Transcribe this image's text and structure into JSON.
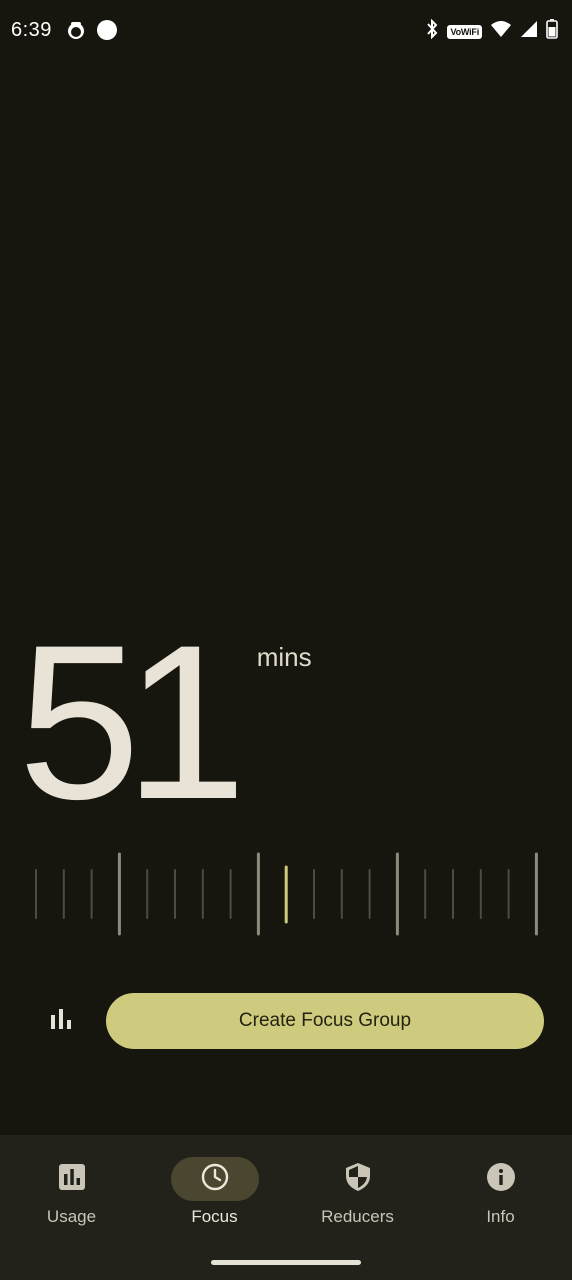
{
  "status_bar": {
    "time": "6:39",
    "network_badge": "VoWiFi"
  },
  "timer": {
    "value": "51",
    "unit": "mins"
  },
  "ruler": {
    "tick_count": 19,
    "selected_index": 9,
    "major_every": 5
  },
  "actions": {
    "stats_icon": "bar-chart-icon",
    "create_label": "Create Focus Group"
  },
  "nav": {
    "items": [
      {
        "label": "Usage",
        "icon": "usage-chart-icon",
        "active": false
      },
      {
        "label": "Focus",
        "icon": "clock-icon",
        "active": true
      },
      {
        "label": "Reducers",
        "icon": "shield-icon",
        "active": false
      },
      {
        "label": "Info",
        "icon": "info-icon",
        "active": false
      }
    ]
  },
  "colors": {
    "background": "#16150e",
    "accent": "#cfcb7e",
    "text": "#e8e3d6",
    "nav_background": "#22211a",
    "nav_active_pill": "#4a4630"
  }
}
